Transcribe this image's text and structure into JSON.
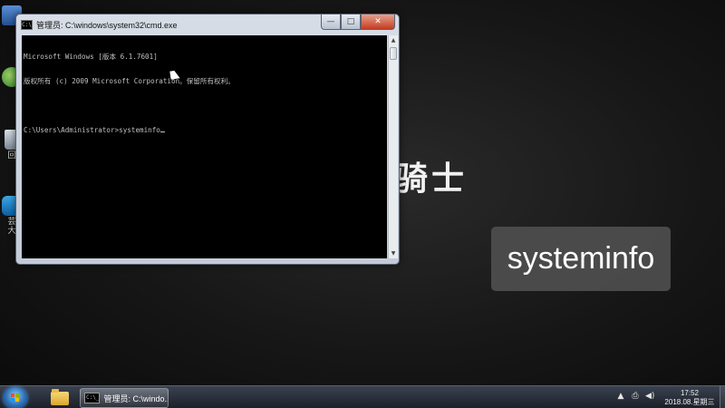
{
  "desktop": {
    "icons": [
      {
        "icon": "computer-icon",
        "label": ""
      },
      {
        "icon": "network-icon",
        "label": ""
      },
      {
        "icon": "recycle-bin-icon",
        "label": "回"
      },
      {
        "icon": "cloud-app-icon",
        "label": "芸\n大"
      }
    ],
    "background_text": "骑士",
    "caption": "systeminfo"
  },
  "cmd_window": {
    "title": "管理员: C:\\windows\\system32\\cmd.exe",
    "console_lines": [
      "Microsoft Windows [版本 6.1.7601]",
      "版权所有 (c) 2009 Microsoft Corporation。保留所有权利。",
      "",
      "C:\\Users\\Administrator>systeminfo"
    ],
    "buttons": {
      "minimize": "—",
      "maximize": "□",
      "close": "✕"
    }
  },
  "taskbar": {
    "cmd_task_label": "管理员: C:\\windo...",
    "tray_icons": [
      "▲",
      "⎙",
      "◀)"
    ],
    "clock": {
      "time": "17:52",
      "date": "2018.08.星期三"
    }
  },
  "colors": {
    "console_bg": "#000000",
    "console_text": "#c0c0c0",
    "close_button": "#c43d21",
    "caption_bg": "#4e4e4e"
  }
}
